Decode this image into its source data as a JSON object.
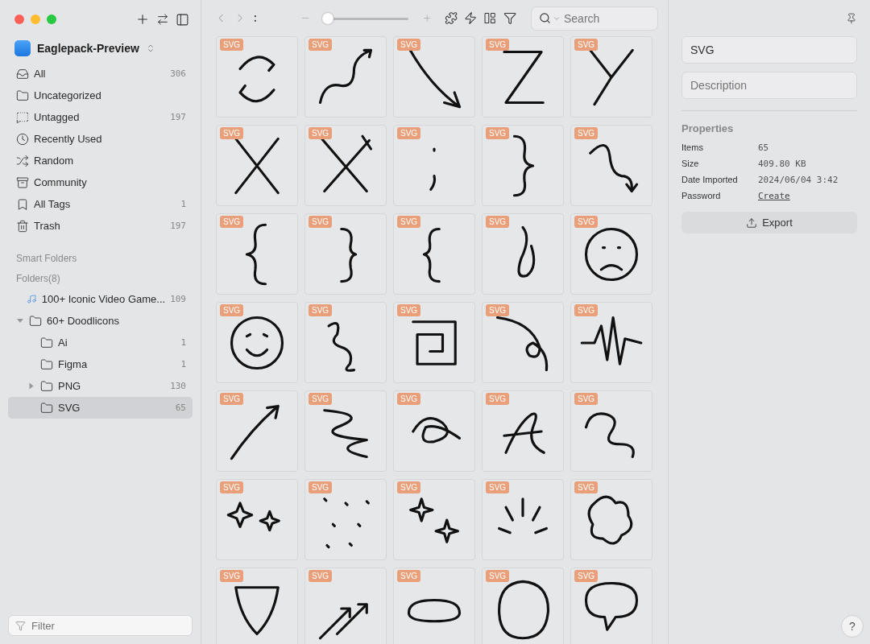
{
  "sidebar": {
    "library": "Eaglepack-Preview",
    "items": [
      {
        "label": "All",
        "count": "306"
      },
      {
        "label": "Uncategorized"
      },
      {
        "label": "Untagged",
        "count": "197"
      },
      {
        "label": "Recently Used"
      },
      {
        "label": "Random"
      },
      {
        "label": "Community"
      },
      {
        "label": "All Tags",
        "count": "1"
      },
      {
        "label": "Trash",
        "count": "197"
      }
    ],
    "smart_folders_heading": "Smart Folders",
    "folders_heading": "Folders(8)",
    "folders": [
      {
        "label": "100+ Iconic Video Game...",
        "count": "109",
        "selected": false
      },
      {
        "label": "60+ Doodlicons",
        "selected": false,
        "expanded": true,
        "children": [
          {
            "label": "Ai",
            "count": "1",
            "selected": false
          },
          {
            "label": "Figma",
            "count": "1",
            "selected": false
          },
          {
            "label": "PNG",
            "count": "130",
            "selected": false,
            "expanded": false
          },
          {
            "label": "SVG",
            "count": "65",
            "selected": true
          }
        ]
      }
    ],
    "filter": {
      "placeholder": "Filter"
    }
  },
  "toolbar": {
    "zoom": {
      "level": 0.05
    },
    "search": {
      "placeholder": "Search"
    }
  },
  "grid": {
    "items": [
      {
        "badge": "SVG"
      },
      {
        "badge": "SVG"
      },
      {
        "badge": "SVG"
      },
      {
        "badge": "SVG"
      },
      {
        "badge": "SVG"
      },
      {
        "badge": "SVG"
      },
      {
        "badge": "SVG"
      },
      {
        "badge": "SVG"
      },
      {
        "badge": "SVG"
      },
      {
        "badge": "SVG"
      },
      {
        "badge": "SVG"
      },
      {
        "badge": "SVG"
      },
      {
        "badge": "SVG"
      },
      {
        "badge": "SVG"
      },
      {
        "badge": "SVG"
      },
      {
        "badge": "SVG"
      },
      {
        "badge": "SVG"
      },
      {
        "badge": "SVG"
      },
      {
        "badge": "SVG"
      },
      {
        "badge": "SVG"
      },
      {
        "badge": "SVG"
      },
      {
        "badge": "SVG"
      },
      {
        "badge": "SVG"
      },
      {
        "badge": "SVG"
      },
      {
        "badge": "SVG"
      },
      {
        "badge": "SVG"
      },
      {
        "badge": "SVG"
      },
      {
        "badge": "SVG"
      },
      {
        "badge": "SVG"
      },
      {
        "badge": "SVG"
      },
      {
        "badge": "SVG"
      },
      {
        "badge": "SVG"
      },
      {
        "badge": "SVG"
      },
      {
        "badge": "SVG"
      },
      {
        "badge": "SVG"
      }
    ]
  },
  "inspector": {
    "name": "SVG",
    "description": {
      "placeholder": "Description"
    },
    "properties_heading": "Properties",
    "properties": [
      {
        "label": "Items",
        "value": "65"
      },
      {
        "label": "Size",
        "value": "409.80 KB"
      },
      {
        "label": "Date Imported",
        "value": "2024/06/04 3:42"
      },
      {
        "label": "Password",
        "value": "Create",
        "kind": "link"
      }
    ],
    "export": "Export",
    "help": "?"
  }
}
